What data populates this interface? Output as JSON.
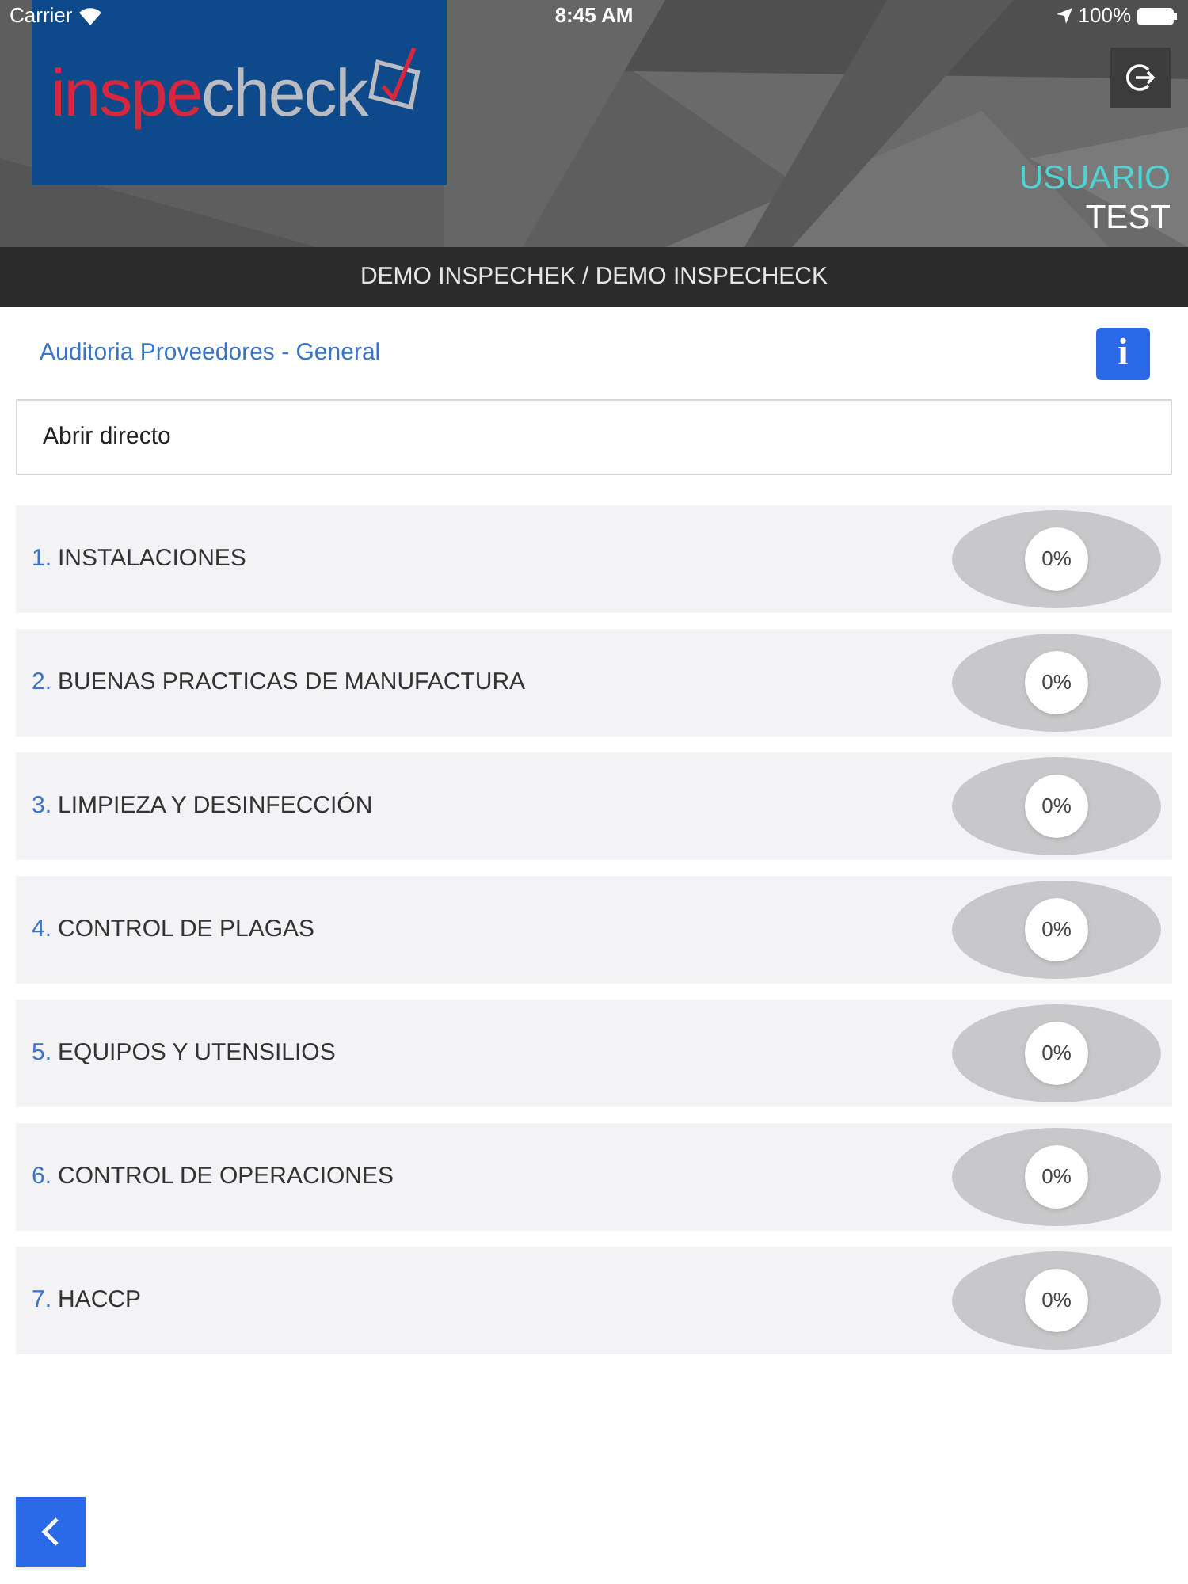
{
  "status_bar": {
    "carrier": "Carrier",
    "time": "8:45 AM",
    "battery": "100%"
  },
  "header": {
    "logo": {
      "lead": "inspe",
      "tail": "check"
    },
    "user_label": "USUARIO",
    "user_name": "TEST"
  },
  "company_bar": {
    "title": "DEMO INSPECHEK / DEMO INSPECHECK"
  },
  "audit": {
    "title": "Auditoria Proveedores - General",
    "info_button": "i"
  },
  "open_direct": {
    "label": "Abrir directo"
  },
  "sections": [
    {
      "number": "1.",
      "name": "INSTALACIONES",
      "progress": "0%"
    },
    {
      "number": "2.",
      "name": "BUENAS PRACTICAS DE MANUFACTURA",
      "progress": "0%"
    },
    {
      "number": "3.",
      "name": "LIMPIEZA Y DESINFECCIÓN",
      "progress": "0%"
    },
    {
      "number": "4.",
      "name": "CONTROL DE PLAGAS",
      "progress": "0%"
    },
    {
      "number": "5.",
      "name": "EQUIPOS Y UTENSILIOS",
      "progress": "0%"
    },
    {
      "number": "6.",
      "name": "CONTROL DE OPERACIONES",
      "progress": "0%"
    },
    {
      "number": "7.",
      "name": "HACCP",
      "progress": "0%"
    }
  ]
}
